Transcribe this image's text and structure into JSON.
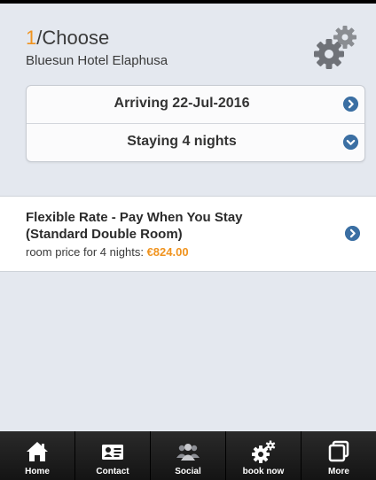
{
  "header": {
    "step_number": "1",
    "step_title": "/Choose",
    "hotel_name": "Bluesun Hotel Elaphusa",
    "settings_icon": "gears-icon"
  },
  "booking": {
    "arrival_label": "Arriving 22-Jul-2016",
    "stay_label": "Staying 4 nights",
    "arrival_icon": "chevron-right-circle-icon",
    "stay_icon": "chevron-down-circle-icon"
  },
  "rate": {
    "title_line1": "Flexible Rate - Pay When You Stay",
    "title_line2": "(Standard Double Room)",
    "price_prefix": "room price for 4 nights:",
    "price_amount": "€824.00",
    "price_color": "#f0931e"
  },
  "tabs": [
    {
      "label": "Home",
      "icon": "home-icon"
    },
    {
      "label": "Contact",
      "icon": "contact-card-icon"
    },
    {
      "label": "Social",
      "icon": "social-people-icon"
    },
    {
      "label": "book now",
      "icon": "gears-icon"
    },
    {
      "label": "More",
      "icon": "more-windows-icon"
    }
  ],
  "colors": {
    "accent": "#f0931e",
    "icon_blue": "#3b6fa3",
    "background": "#e4e8ef",
    "tabbar": "#1e1e1e"
  }
}
